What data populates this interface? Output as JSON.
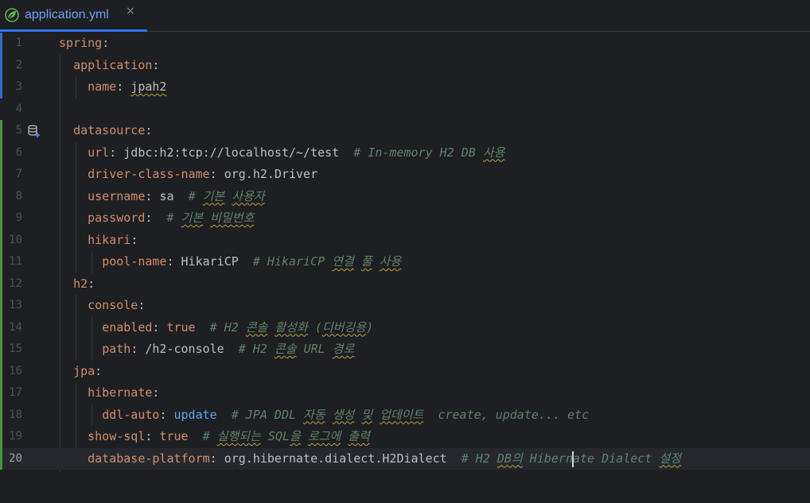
{
  "tab": {
    "label": "application.yml",
    "close_glyph": "×",
    "icon": "spring-leaf-icon",
    "active_color": "#3574f0"
  },
  "colors": {
    "key": "#cf8e6d",
    "value": "#bcbec4",
    "keyword": "#56a8f5",
    "comment": "#5f826b",
    "line_number": "#4b5059",
    "vcs_modified": "#3d64c7",
    "vcs_added": "#4e8f45",
    "background": "#1e1f22"
  },
  "gutter": {
    "datasource_icon": "database-plus-icon"
  },
  "lines": [
    {
      "num": "1",
      "vcs": "modified",
      "tokens": [
        {
          "t": "k",
          "s": "spring"
        },
        {
          "t": "p",
          "s": ":"
        }
      ]
    },
    {
      "num": "2",
      "vcs": "modified",
      "tokens": [
        {
          "t": "p",
          "s": "  "
        },
        {
          "t": "k",
          "s": "application"
        },
        {
          "t": "p",
          "s": ":"
        }
      ]
    },
    {
      "num": "3",
      "vcs": "modified",
      "tokens": [
        {
          "t": "p",
          "s": "    "
        },
        {
          "t": "k",
          "s": "name"
        },
        {
          "t": "p",
          "s": ": "
        },
        {
          "t": "v",
          "s": "jpah2",
          "sq": true
        }
      ]
    },
    {
      "num": "4",
      "vcs": "none",
      "tokens": []
    },
    {
      "num": "5",
      "vcs": "added",
      "icon": true,
      "tokens": [
        {
          "t": "p",
          "s": "  "
        },
        {
          "t": "k",
          "s": "datasource"
        },
        {
          "t": "p",
          "s": ":"
        }
      ]
    },
    {
      "num": "6",
      "vcs": "added",
      "tokens": [
        {
          "t": "p",
          "s": "    "
        },
        {
          "t": "k",
          "s": "url"
        },
        {
          "t": "p",
          "s": ": "
        },
        {
          "t": "v",
          "s": "jdbc:h2:tcp://localhost/~/test"
        },
        {
          "t": "p",
          "s": "  "
        },
        {
          "t": "c",
          "s": "# In-memory H2 DB "
        },
        {
          "t": "c",
          "s": "사용",
          "sq": true
        }
      ]
    },
    {
      "num": "7",
      "vcs": "added",
      "tokens": [
        {
          "t": "p",
          "s": "    "
        },
        {
          "t": "k",
          "s": "driver-class-name"
        },
        {
          "t": "p",
          "s": ": "
        },
        {
          "t": "v",
          "s": "org.h2.Driver"
        }
      ]
    },
    {
      "num": "8",
      "vcs": "added",
      "tokens": [
        {
          "t": "p",
          "s": "    "
        },
        {
          "t": "k",
          "s": "username"
        },
        {
          "t": "p",
          "s": ": "
        },
        {
          "t": "v",
          "s": "sa"
        },
        {
          "t": "p",
          "s": "  "
        },
        {
          "t": "c",
          "s": "# "
        },
        {
          "t": "c",
          "s": "기본",
          "sq": true
        },
        {
          "t": "c",
          "s": " "
        },
        {
          "t": "c",
          "s": "사용자",
          "sq": true
        }
      ]
    },
    {
      "num": "9",
      "vcs": "added",
      "tokens": [
        {
          "t": "p",
          "s": "    "
        },
        {
          "t": "k",
          "s": "password"
        },
        {
          "t": "p",
          "s": ":  "
        },
        {
          "t": "c",
          "s": "# "
        },
        {
          "t": "c",
          "s": "기본",
          "sq": true
        },
        {
          "t": "c",
          "s": " "
        },
        {
          "t": "c",
          "s": "비밀번호",
          "sq": true
        }
      ]
    },
    {
      "num": "10",
      "vcs": "added",
      "tokens": [
        {
          "t": "p",
          "s": "    "
        },
        {
          "t": "k",
          "s": "hikari"
        },
        {
          "t": "p",
          "s": ":"
        }
      ]
    },
    {
      "num": "11",
      "vcs": "added",
      "tokens": [
        {
          "t": "p",
          "s": "      "
        },
        {
          "t": "k",
          "s": "pool-name"
        },
        {
          "t": "p",
          "s": ": "
        },
        {
          "t": "v",
          "s": "HikariCP"
        },
        {
          "t": "p",
          "s": "  "
        },
        {
          "t": "c",
          "s": "# HikariCP "
        },
        {
          "t": "c",
          "s": "연결",
          "sq": true
        },
        {
          "t": "c",
          "s": " "
        },
        {
          "t": "c",
          "s": "풀",
          "sq": true
        },
        {
          "t": "c",
          "s": " "
        },
        {
          "t": "c",
          "s": "사용",
          "sq": true
        }
      ]
    },
    {
      "num": "12",
      "vcs": "added",
      "tokens": [
        {
          "t": "p",
          "s": "  "
        },
        {
          "t": "k",
          "s": "h2"
        },
        {
          "t": "p",
          "s": ":"
        }
      ]
    },
    {
      "num": "13",
      "vcs": "added",
      "tokens": [
        {
          "t": "p",
          "s": "    "
        },
        {
          "t": "k",
          "s": "console"
        },
        {
          "t": "p",
          "s": ":"
        }
      ]
    },
    {
      "num": "14",
      "vcs": "added",
      "tokens": [
        {
          "t": "p",
          "s": "      "
        },
        {
          "t": "k",
          "s": "enabled"
        },
        {
          "t": "p",
          "s": ": "
        },
        {
          "t": "k",
          "s": "true"
        },
        {
          "t": "p",
          "s": "  "
        },
        {
          "t": "c",
          "s": "# H2 "
        },
        {
          "t": "c",
          "s": "콘솔",
          "sq": true
        },
        {
          "t": "c",
          "s": " "
        },
        {
          "t": "c",
          "s": "활성화",
          "sq": true
        },
        {
          "t": "c",
          "s": " ("
        },
        {
          "t": "c",
          "s": "디버깅용",
          "sq": true
        },
        {
          "t": "c",
          "s": ")"
        }
      ]
    },
    {
      "num": "15",
      "vcs": "added",
      "tokens": [
        {
          "t": "p",
          "s": "      "
        },
        {
          "t": "k",
          "s": "path"
        },
        {
          "t": "p",
          "s": ": "
        },
        {
          "t": "v",
          "s": "/h2-console"
        },
        {
          "t": "p",
          "s": "  "
        },
        {
          "t": "c",
          "s": "# H2 "
        },
        {
          "t": "c",
          "s": "콘솔",
          "sq": true
        },
        {
          "t": "c",
          "s": " URL "
        },
        {
          "t": "c",
          "s": "경로",
          "sq": true
        }
      ]
    },
    {
      "num": "16",
      "vcs": "added",
      "tokens": [
        {
          "t": "p",
          "s": "  "
        },
        {
          "t": "k",
          "s": "jpa"
        },
        {
          "t": "p",
          "s": ":"
        }
      ]
    },
    {
      "num": "17",
      "vcs": "added",
      "tokens": [
        {
          "t": "p",
          "s": "    "
        },
        {
          "t": "k",
          "s": "hibernate"
        },
        {
          "t": "p",
          "s": ":"
        }
      ]
    },
    {
      "num": "18",
      "vcs": "added",
      "tokens": [
        {
          "t": "p",
          "s": "      "
        },
        {
          "t": "k",
          "s": "ddl-auto"
        },
        {
          "t": "p",
          "s": ": "
        },
        {
          "t": "b",
          "s": "update"
        },
        {
          "t": "p",
          "s": "  "
        },
        {
          "t": "c",
          "s": "# JPA DDL "
        },
        {
          "t": "c",
          "s": "자동",
          "sq": true
        },
        {
          "t": "c",
          "s": " "
        },
        {
          "t": "c",
          "s": "생성",
          "sq": true
        },
        {
          "t": "c",
          "s": " "
        },
        {
          "t": "c",
          "s": "및",
          "sq": true
        },
        {
          "t": "c",
          "s": " "
        },
        {
          "t": "c",
          "s": "업데이트",
          "sq": true
        },
        {
          "t": "c",
          "s": "  create, update... etc"
        }
      ]
    },
    {
      "num": "19",
      "vcs": "added",
      "tokens": [
        {
          "t": "p",
          "s": "    "
        },
        {
          "t": "k",
          "s": "show-sql"
        },
        {
          "t": "p",
          "s": ": "
        },
        {
          "t": "k",
          "s": "true"
        },
        {
          "t": "p",
          "s": "  "
        },
        {
          "t": "c",
          "s": "# "
        },
        {
          "t": "c",
          "s": "실행되는",
          "sq": true
        },
        {
          "t": "c",
          "s": " SQL"
        },
        {
          "t": "c",
          "s": "을",
          "sq": true
        },
        {
          "t": "c",
          "s": " "
        },
        {
          "t": "c",
          "s": "로그에",
          "sq": true
        },
        {
          "t": "c",
          "s": " "
        },
        {
          "t": "c",
          "s": "출력",
          "sq": true
        }
      ]
    },
    {
      "num": "20",
      "vcs": "added",
      "current": true,
      "tokens": [
        {
          "t": "p",
          "s": "    "
        },
        {
          "t": "k",
          "s": "database-platform"
        },
        {
          "t": "p",
          "s": ": "
        },
        {
          "t": "v",
          "s": "org.hibernate.dialect.H2Dialect"
        },
        {
          "t": "p",
          "s": "  "
        },
        {
          "t": "c",
          "s": "# H2 "
        },
        {
          "t": "c",
          "s": "DB의",
          "sq": true
        },
        {
          "t": "c",
          "s": " Hibernate Dialect "
        },
        {
          "t": "c",
          "s": "설정",
          "sq": true
        }
      ]
    }
  ]
}
